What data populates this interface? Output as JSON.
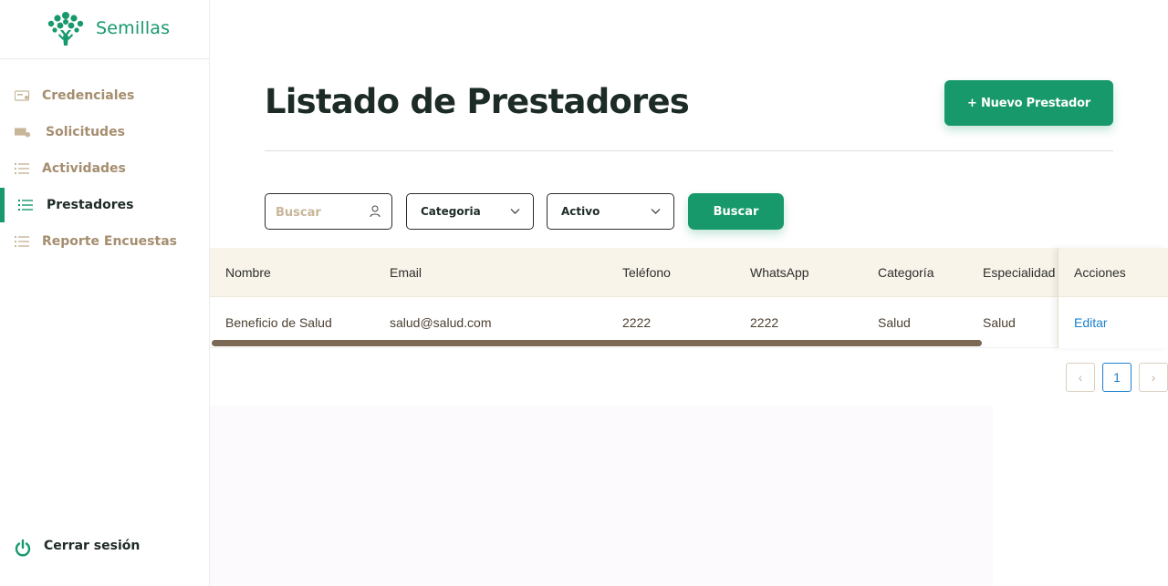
{
  "brand": {
    "name": "Semillas"
  },
  "sidebar": {
    "items": [
      {
        "label": "Credenciales",
        "icon": "credential-card-icon",
        "active": false
      },
      {
        "label": "Solicitudes",
        "icon": "requests-icon",
        "active": false
      },
      {
        "label": "Actividades",
        "icon": "list-icon",
        "active": false
      },
      {
        "label": "Prestadores",
        "icon": "list-icon",
        "active": true
      },
      {
        "label": "Reporte Encuestas",
        "icon": "list-icon",
        "active": false
      }
    ],
    "logout_label": "Cerrar sesión"
  },
  "header": {
    "title": "Listado de Prestadores",
    "new_button": "+ Nuevo Prestador"
  },
  "filters": {
    "search_placeholder": "Buscar",
    "category": "Categoria",
    "status": "Activo",
    "search_button": "Buscar"
  },
  "table": {
    "columns": [
      "Nombre",
      "Email",
      "Teléfono",
      "WhatsApp",
      "Categoría",
      "Especialidad",
      "Acciones"
    ],
    "rows": [
      {
        "nombre": "Beneficio de Salud",
        "email": "salud@salud.com",
        "telefono": "2222",
        "whatsapp": "2222",
        "categoria": "Salud",
        "especialidad": "Salud",
        "accion": "Editar"
      }
    ]
  },
  "pagination": {
    "prev": "‹",
    "current": "1",
    "next": "›"
  },
  "colors": {
    "primary": "#17996b",
    "nav_text": "#a58e6f",
    "header_bg": "#f8f4e9",
    "link": "#1b7fcc"
  }
}
